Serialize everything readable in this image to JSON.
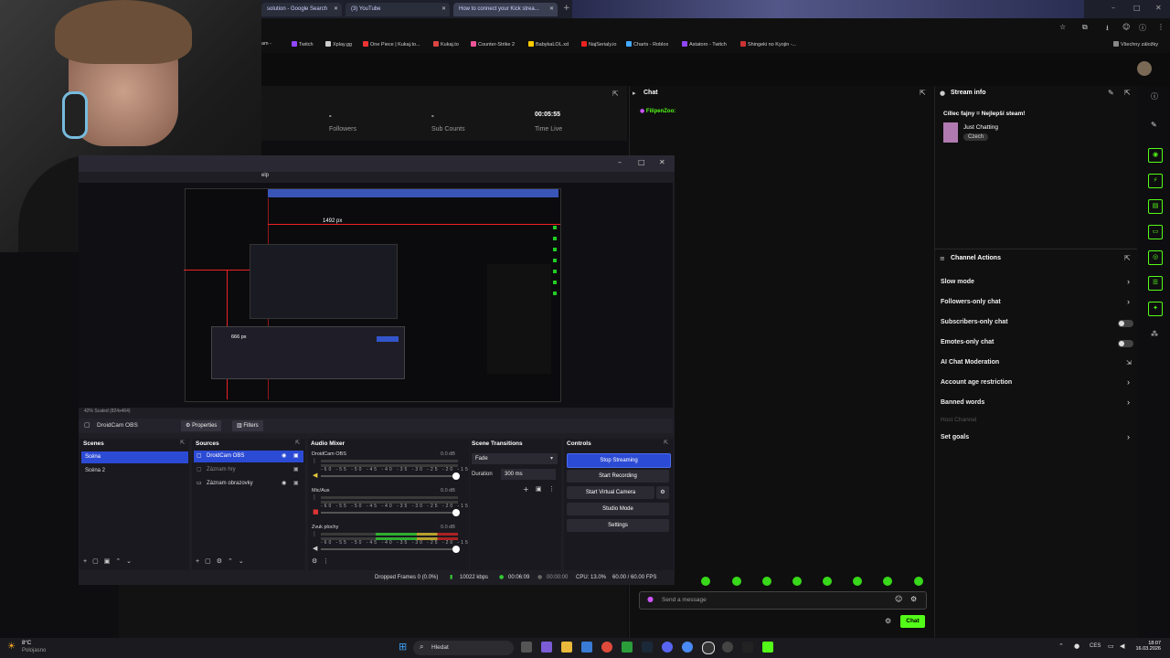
{
  "browser": {
    "tabs": [
      {
        "title": "solution - Google Search",
        "active": false
      },
      {
        "title": "(3) YouTube",
        "active": false
      },
      {
        "title": "How to connect your Kick strea...",
        "active": true
      }
    ],
    "bookmarks": [
      "am -",
      "Twitch",
      "Xplay.gg",
      "One Piece | Kukaj.to...",
      "Kukaj.to",
      "Counter-Strike 2",
      "BabykaLOL.xd",
      "NajSerialy.io",
      "Charts - Roblox",
      "Astatoro - Twitch",
      "Shingeki no Kyojin -..."
    ],
    "all_bookmarks": "Všechny záložky"
  },
  "stats": {
    "followers_value": "-",
    "followers_label": "Followers",
    "subs_value": "-",
    "subs_label": "Sub Counts",
    "time_value": "00:05:55",
    "time_label": "Time Live"
  },
  "chat": {
    "title": "Chat",
    "user": "FilipenZoo:",
    "placeholder": "Send a message",
    "send_label": "Chat"
  },
  "stream_info": {
    "title": "Stream info",
    "stream_title": "Cíllec fajny = Nejlepší steam!",
    "category": "Just Chatting",
    "language": "Czech"
  },
  "channel_actions": {
    "title": "Channel Actions",
    "items": [
      "Slow mode",
      "Followers-only chat",
      "Subscribers-only chat",
      "Emotes-only chat",
      "AI Chat Moderation",
      "Account age restriction",
      "Banned words",
      "Host Channel",
      "Set goals"
    ]
  },
  "obs": {
    "menu_fragment": "elp",
    "preview_label_1": "1492 px",
    "preview_label_2": "666 px",
    "zoom_text": "42%  Scaled (824x464)",
    "source_name": "DroidCam OBS",
    "properties_label": "Properties",
    "filters_label": "Filters",
    "scenes_title": "Scenes",
    "scenes": [
      "Scéna",
      "Scéna 2"
    ],
    "sources_title": "Sources",
    "sources": [
      "DroidCam OBS",
      "Záznam hry",
      "Záznam obrazovky"
    ],
    "mixer_title": "Audio Mixer",
    "mixer_channels": [
      {
        "name": "DroidCam OBS",
        "db": "0.0 dB"
      },
      {
        "name": "Mic/Aux",
        "db": "0.0 dB"
      },
      {
        "name": "Zvuk plochy",
        "db": "0.0 dB"
      }
    ],
    "meter_scale": "-60 -55 -50 -45 -40 -35 -30 -25 -20 -15 -10 -5 0",
    "transitions_title": "Scene Transitions",
    "transition": "Fade",
    "duration_label": "Duration",
    "duration_value": "300 ms",
    "controls_title": "Controls",
    "controls": [
      "Stop Streaming",
      "Start Recording",
      "Start Virtual Camera",
      "Studio Mode",
      "Settings"
    ],
    "status": {
      "dropped": "Dropped Frames 0 (0.0%)",
      "kbps": "10022 kbps",
      "stream_time": "00:06:09",
      "rec_time": "00:00:00",
      "cpu": "CPU: 13.0%",
      "fps": "60.00 / 60.00 FPS"
    }
  },
  "taskbar": {
    "weather_temp": "8°C",
    "weather_desc": "Polojasno",
    "search": "Hledat",
    "lang": "CES",
    "time": "18:07",
    "date": "16.03.2026"
  },
  "colors": {
    "kick_green": "#53fc18",
    "obs_blue": "#2c4bd4",
    "obs_bg": "#1f1e25"
  }
}
